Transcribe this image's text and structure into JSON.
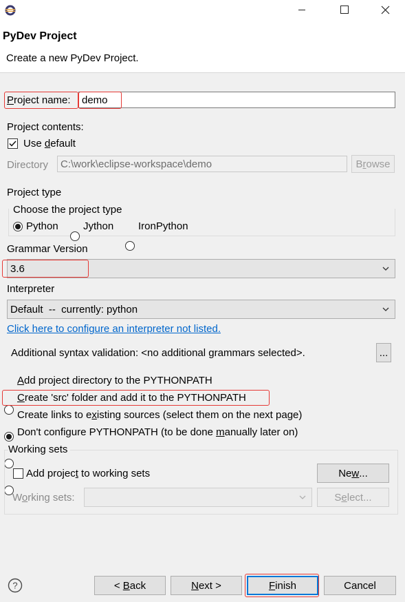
{
  "window": {
    "title": "PyDev Project",
    "description": "Create a new PyDev Project.",
    "minimize_icon": "minimize-icon",
    "maximize_icon": "maximize-icon",
    "close_icon": "close-icon"
  },
  "project_name": {
    "label_pre": "P",
    "label_post": "roject name:",
    "value": "demo"
  },
  "project_contents": {
    "label": "Project contents:",
    "use_default": {
      "pre": "Use ",
      "mnemonic": "d",
      "post": "efault",
      "checked": true
    },
    "directory_label": "Directory",
    "directory_value": "C:\\work\\eclipse-workspace\\demo",
    "browse_pre": "B",
    "browse_mnemonic": "r",
    "browse_post": "owse"
  },
  "project_type": {
    "label": "Project type",
    "group_label": "Choose the project type",
    "options": [
      "Python",
      "Jython",
      "IronPython"
    ],
    "selected": "Python"
  },
  "grammar": {
    "label": "Grammar Version",
    "value": "3.6"
  },
  "interpreter": {
    "label": "Interpreter",
    "value": "Default  --  currently: python",
    "config_link": "Click here to configure an interpreter not listed."
  },
  "syntax": {
    "label": "Additional syntax validation: <no additional grammars selected>.",
    "button": "..."
  },
  "pythonpath": {
    "opt1_pre": "",
    "opt1_mn": "A",
    "opt1_post": "dd project directory to the PYTHONPATH",
    "opt2_pre": "",
    "opt2_mn": "C",
    "opt2_post": "reate 'src' folder and add it to the PYTHONPATH",
    "opt3_pre": "Create links to e",
    "opt3_mn": "x",
    "opt3_post": "isting sources (select them on the next page)",
    "opt4_pre": "Don't configure PYTHONPATH (to be done ",
    "opt4_mn": "m",
    "opt4_post": "anually later on)",
    "selected": 2
  },
  "working_sets": {
    "label": "Working sets",
    "add_pre": "Add projec",
    "add_mn": "t",
    "add_post": " to working sets",
    "new_pre": "Ne",
    "new_mn": "w",
    "new_post": "...",
    "sets_pre": "W",
    "sets_mn": "o",
    "sets_post": "rking sets:",
    "select_pre": "S",
    "select_mn": "e",
    "select_post": "lect..."
  },
  "footer": {
    "help_icon": "help-icon",
    "back_pre": "< ",
    "back_mn": "B",
    "back_post": "ack",
    "next_pre": "",
    "next_mn": "N",
    "next_post": "ext >",
    "finish_pre": "",
    "finish_mn": "F",
    "finish_post": "inish",
    "cancel": "Cancel"
  },
  "colors": {
    "highlight": "#e53935",
    "link": "#0066cc",
    "default_button": "#0078d7"
  }
}
